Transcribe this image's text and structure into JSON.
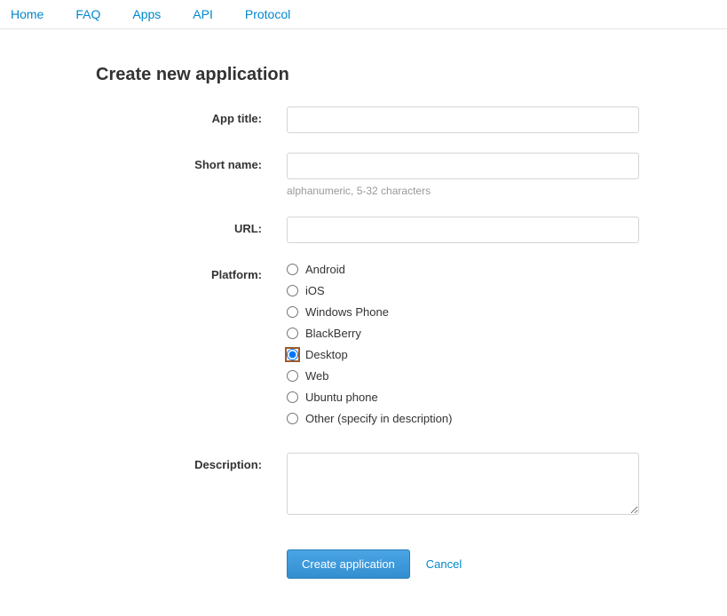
{
  "nav": {
    "home": "Home",
    "faq": "FAQ",
    "apps": "Apps",
    "api": "API",
    "protocol": "Protocol"
  },
  "page": {
    "title": "Create new application"
  },
  "form": {
    "app_title": {
      "label": "App title:",
      "value": ""
    },
    "short_name": {
      "label": "Short name:",
      "value": "",
      "help": "alphanumeric, 5-32 characters"
    },
    "url": {
      "label": "URL:",
      "value": ""
    },
    "platform": {
      "label": "Platform:",
      "options": [
        "Android",
        "iOS",
        "Windows Phone",
        "BlackBerry",
        "Desktop",
        "Web",
        "Ubuntu phone",
        "Other (specify in description)"
      ],
      "selected": "Desktop"
    },
    "description": {
      "label": "Description:",
      "value": ""
    },
    "submit_label": "Create application",
    "cancel_label": "Cancel"
  }
}
